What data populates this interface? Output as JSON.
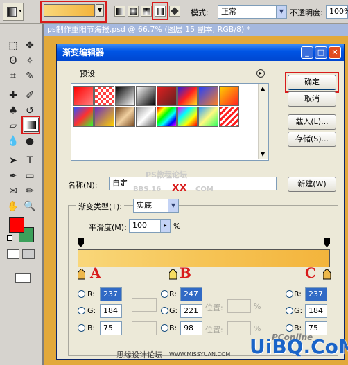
{
  "optbar": {
    "mode_label": "模式:",
    "mode_value": "正常",
    "opacity_label": "不透明度:",
    "opacity_value": "100%"
  },
  "document": {
    "title": "ps制作重阳节海报.psd @ 66.7% (图层 15 副本, RGB/8) *"
  },
  "dialog": {
    "title": "渐变编辑器",
    "presets_label": "预设",
    "ok": "确定",
    "cancel": "取消",
    "load": "载入(L)...",
    "save": "存储(S)...",
    "name_label": "名称(N):",
    "name_value": "自定",
    "new_button": "新建(W)",
    "grad_type_label": "渐变类型(T):",
    "grad_type_value": "实底",
    "smooth_label": "平滑度(M):",
    "smooth_value": "100",
    "smooth_unit": "%",
    "stops": [
      {
        "letter": "A",
        "r": "237",
        "g": "184",
        "b": "75"
      },
      {
        "letter": "B",
        "r": "247",
        "g": "221",
        "b": "98"
      },
      {
        "letter": "C",
        "r": "237",
        "g": "184",
        "b": "75"
      }
    ],
    "r_label": "R:",
    "g_label": "G:",
    "b_label": "B:",
    "pos_label": "位置:",
    "pct": "%"
  },
  "colors": {
    "stop_a": "#edb84b",
    "stop_b": "#f7dd62",
    "stop_c": "#edb84b",
    "foreground": "#ff0000",
    "background": "#3ca05a",
    "highlight": "#d81b1b"
  },
  "watermarks": {
    "top": "PS教程论坛",
    "top_sub": "BBS.16",
    "top_red": "XX",
    "top_com": "COM",
    "bottom_left": "思缘设计论坛",
    "bottom_url": "WWW.MISSYUAN.COM",
    "brand": "UiBQ.CoM",
    "pcon": "PConline"
  }
}
